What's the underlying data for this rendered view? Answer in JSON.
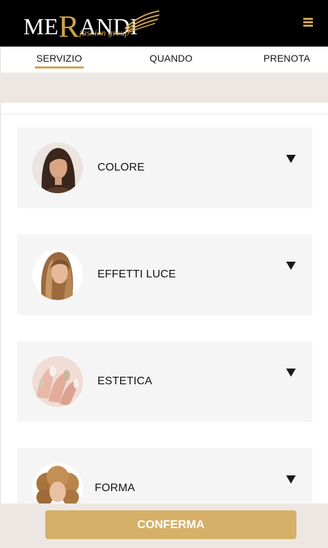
{
  "brand": {
    "logo_text_main": "MERANDI",
    "logo_text_sub": "fashion group",
    "accent_color": "#cfa24a",
    "header_bg": "#000000"
  },
  "header": {
    "menu_icon": "hamburger-icon"
  },
  "tabs": [
    {
      "label": "SERVIZIO",
      "active": true
    },
    {
      "label": "QUANDO",
      "active": false
    },
    {
      "label": "PRENOTA",
      "active": false
    }
  ],
  "services": [
    {
      "label": "COLORE",
      "icon": "chevron-down-icon"
    },
    {
      "label": "EFFETTI LUCE",
      "icon": "chevron-down-icon"
    },
    {
      "label": "ESTETICA",
      "icon": "chevron-down-icon"
    },
    {
      "label": "FORMA",
      "icon": "chevron-down-icon"
    }
  ],
  "footer": {
    "confirm_label": "CONFERMA",
    "confirm_color": "#d6b068"
  }
}
